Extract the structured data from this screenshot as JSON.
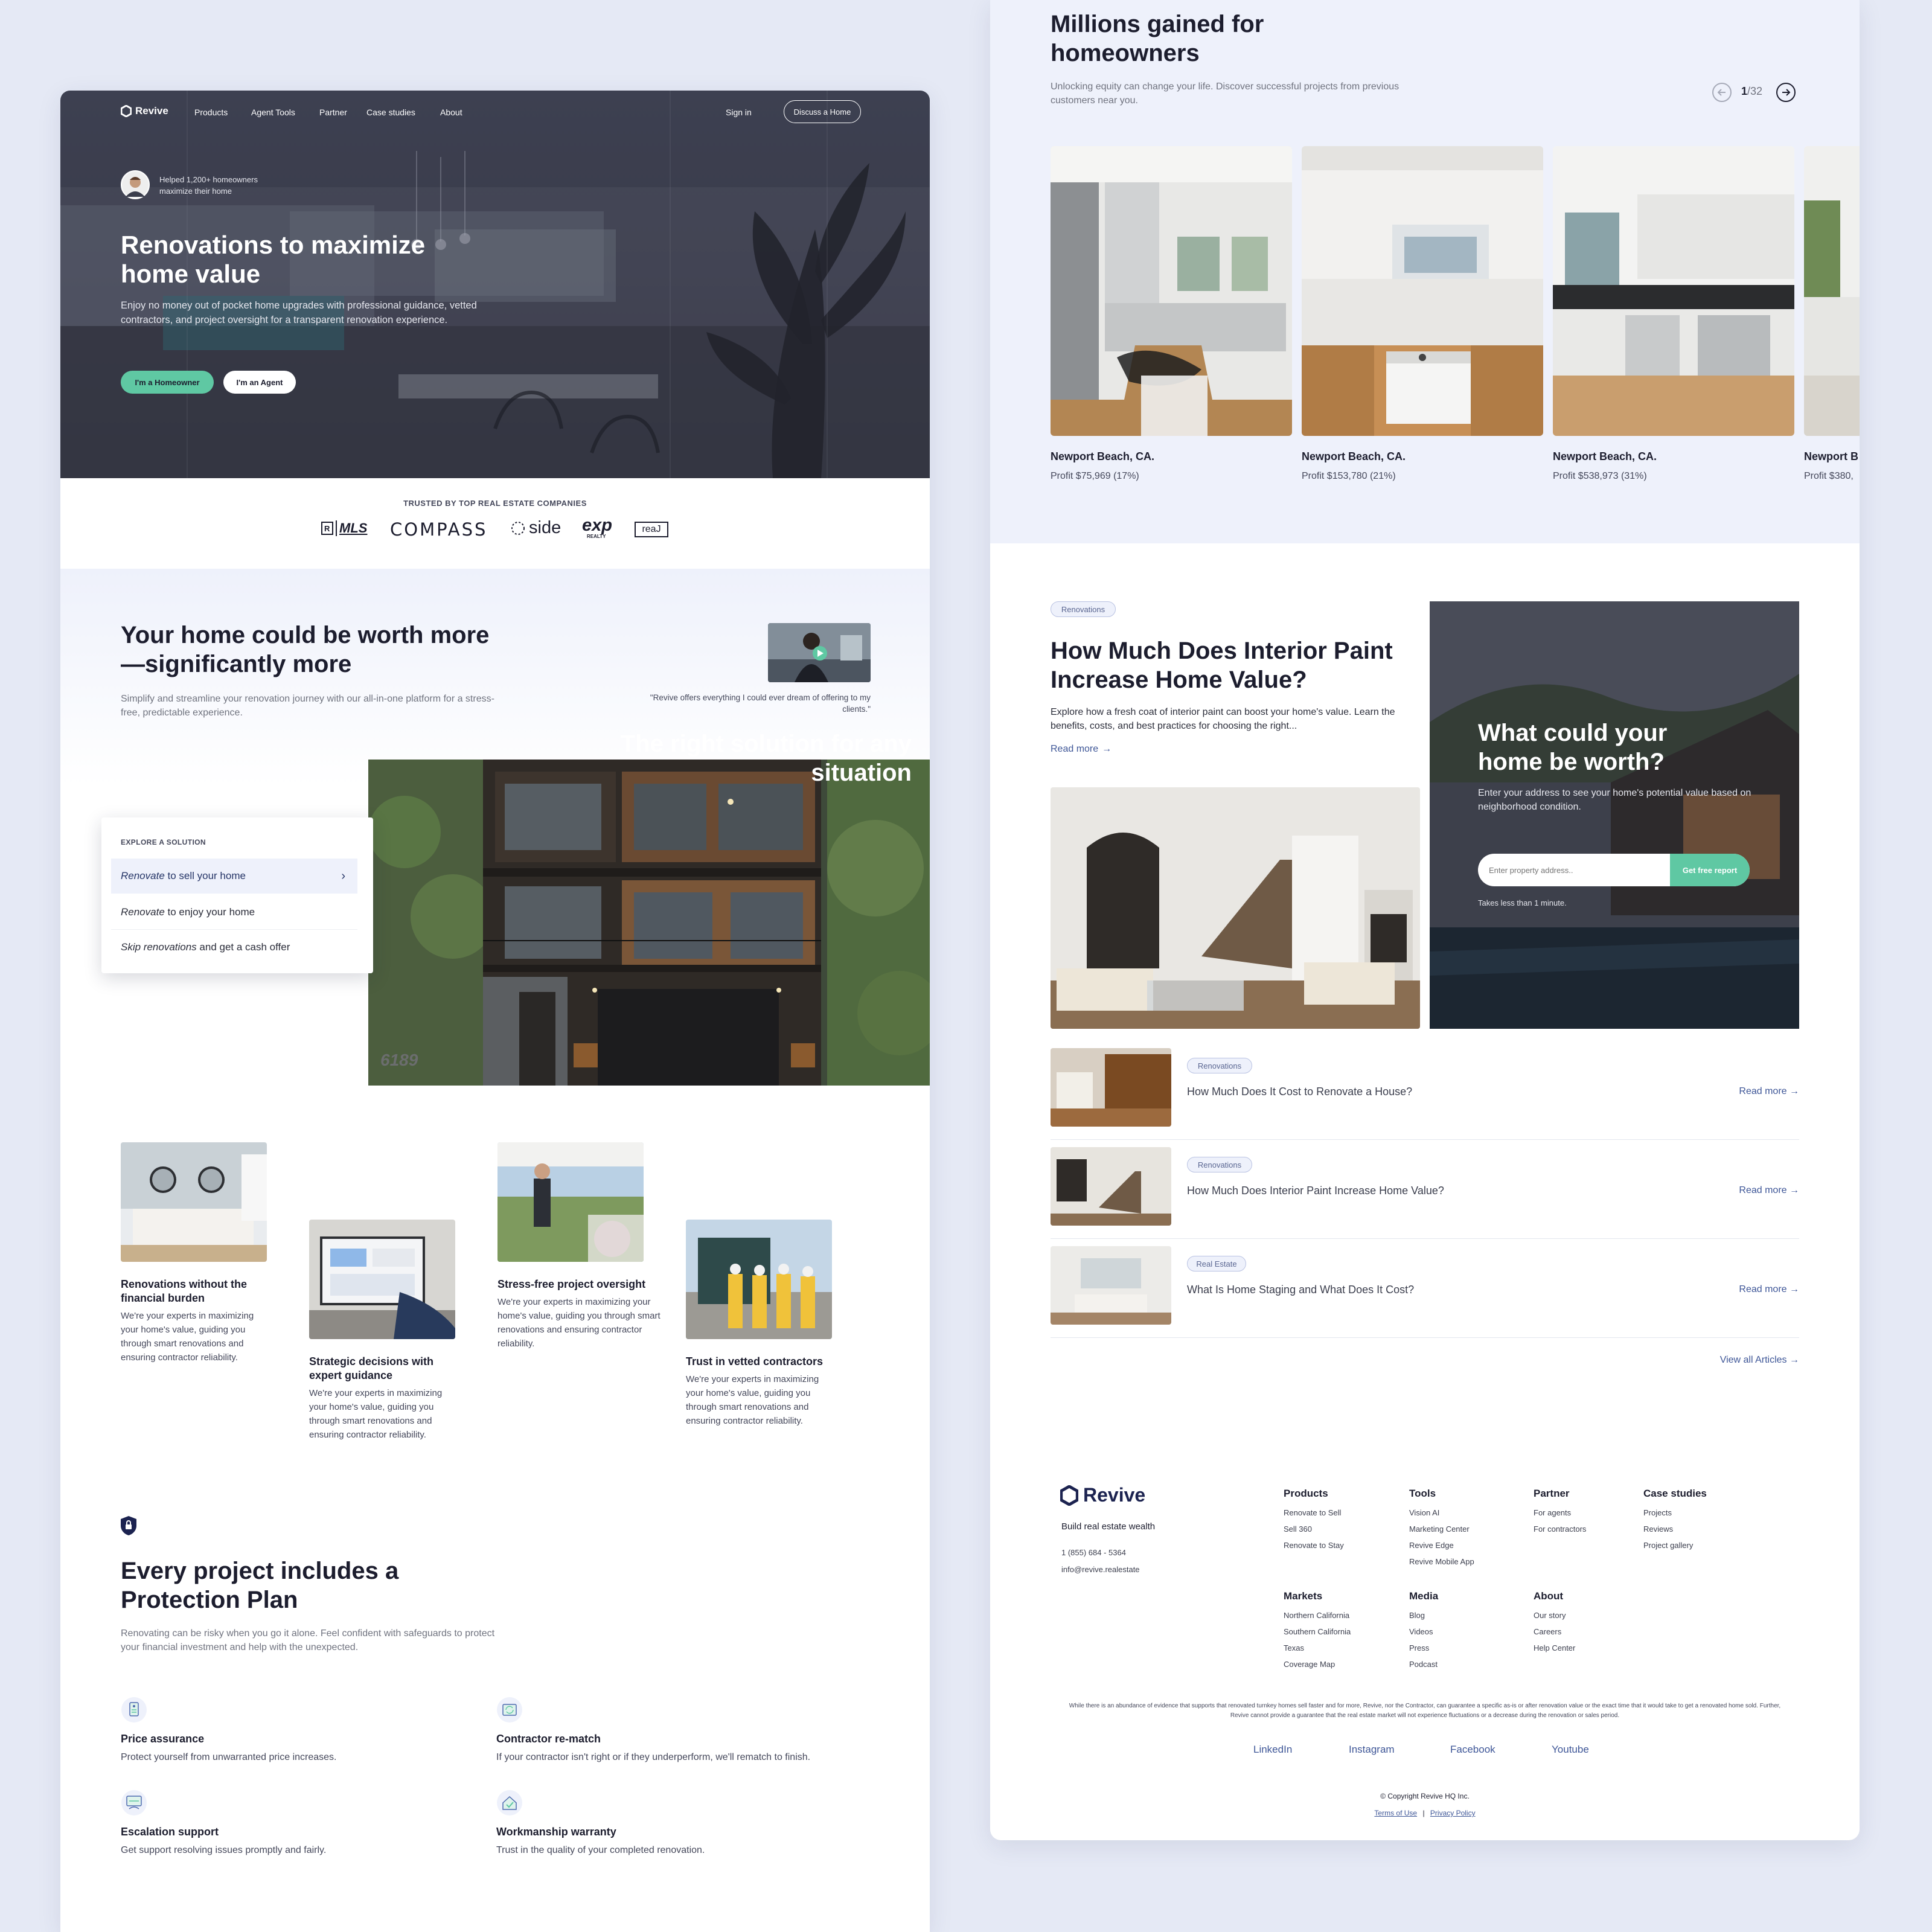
{
  "colors": {
    "accent_green": "#5fc8a3",
    "brand_navy": "#1c2350",
    "link_blue": "#3e5697",
    "bg_lavender": "#e5e9f5",
    "section_tint": "#eef1fb"
  },
  "nav": {
    "logo": "Revive",
    "items": [
      "Products",
      "Agent Tools",
      "Partner",
      "Case studies",
      "About"
    ],
    "sign_in": "Sign in",
    "cta": "Discuss a Home"
  },
  "hero": {
    "badge_line1": "Helped 1,200+ homeowners",
    "badge_line2": "maximize their home",
    "title": "Renovations to maximize home value",
    "subtitle": "Enjoy no money out of pocket home upgrades with professional guidance, vetted contractors, and project oversight for a transparent renovation experience.",
    "btn_homeowner": "I'm a Homeowner",
    "btn_agent": "I'm an Agent"
  },
  "trusted": {
    "label": "TRUSTED BY TOP REAL ESTATE COMPANIES",
    "logos": [
      "MLS",
      "COMPASS",
      "side",
      "exp",
      "reaJ"
    ],
    "exp_sub": "REALTY"
  },
  "worth": {
    "title": "Your home could be worth more—significantly more",
    "subtitle": "Simplify and streamline your renovation journey with our all-in-one platform for a stress-free, predictable experience.",
    "quote": "\"Revive offers everything I could ever dream of offering to my clients.\""
  },
  "solution": {
    "eyebrow": "EXPLORE A SOLUTION",
    "image_title": "The right solution for any situation",
    "house_number": "6189",
    "items": [
      {
        "em": "Renovate",
        "rest": " to sell your home"
      },
      {
        "em": "Renovate",
        "rest": " to enjoy your home"
      },
      {
        "em": "Skip renovations",
        "rest": " and get a cash offer"
      }
    ]
  },
  "features": [
    {
      "title": "Renovations without the financial burden",
      "text": "We're your experts in maximizing your home's value, guiding you through smart renovations and ensuring contractor reliability."
    },
    {
      "title": "Strategic decisions with expert guidance",
      "text": "We're your experts in maximizing your home's value, guiding you through smart renovations and ensuring contractor reliability."
    },
    {
      "title": "Stress-free project oversight",
      "text": "We're your experts in maximizing your home's value, guiding you through smart renovations and ensuring contractor reliability."
    },
    {
      "title": "Trust in vetted contractors",
      "text": "We're your experts in maximizing your home's value, guiding you through smart renovations and ensuring contractor reliability."
    }
  ],
  "protection": {
    "title": "Every project includes a Protection Plan",
    "subtitle": "Renovating can be risky when you go it alone. Feel confident with safeguards to protect your financial investment and help with the unexpected.",
    "items": [
      {
        "title": "Price assurance",
        "text": "Protect yourself from unwarranted price increases.",
        "icon": "price-tag-icon"
      },
      {
        "title": "Contractor re-match",
        "text": "If your contractor isn't right or if they underperform, we'll rematch to finish.",
        "icon": "rematch-icon"
      },
      {
        "title": "Escalation support",
        "text": "Get support resolving issues promptly and fairly.",
        "icon": "support-icon"
      },
      {
        "title": "Workmanship warranty",
        "text": "Trust in the quality of your completed renovation.",
        "icon": "warranty-icon"
      }
    ]
  },
  "millions": {
    "title": "Millions gained for homeowners",
    "subtitle": "Unlocking equity can change your life. Discover successful projects from previous customers near you.",
    "page_current": "1",
    "page_total": "/32",
    "projects": [
      {
        "location": "Newport Beach, CA.",
        "profit": "Profit $75,969 (17%)"
      },
      {
        "location": "Newport Beach, CA.",
        "profit": "Profit $153,780 (21%)"
      },
      {
        "location": "Newport Beach, CA.",
        "profit": "Profit $538,973 (31%)"
      },
      {
        "location": "Newport B",
        "profit": "Profit $380,"
      }
    ]
  },
  "article": {
    "tag": "Renovations",
    "title": "How Much Does Interior Paint Increase Home Value?",
    "excerpt": "Explore how a fresh coat of interior paint can boost your home's value. Learn the benefits, costs, and best practices for choosing the right...",
    "read_more": "Read more"
  },
  "worth_card": {
    "title": "What could your home be worth?",
    "subtitle": "Enter your address to see your home's potential value based on neighborhood condition.",
    "placeholder": "Enter property address..",
    "button": "Get free report",
    "note": "Takes less than 1 minute."
  },
  "articles": [
    {
      "tag": "Renovations",
      "title": "How Much Does It Cost to Renovate a House?",
      "read_more": "Read more"
    },
    {
      "tag": "Renovations",
      "title": "How Much Does Interior Paint Increase Home Value?",
      "read_more": "Read more"
    },
    {
      "tag": "Real Estate",
      "title": "What Is Home Staging and What Does It Cost?",
      "read_more": "Read more"
    }
  ],
  "view_all": "View all Articles",
  "footer": {
    "logo": "Revive",
    "tagline": "Build real estate wealth",
    "phone": "1 (855) 684 - 5364",
    "email": "info@revive.realestate",
    "columns": [
      {
        "head": "Products",
        "links": [
          "Renovate to Sell",
          "Sell 360",
          "Renovate to Stay"
        ]
      },
      {
        "head": "Tools",
        "links": [
          "Vision AI",
          "Marketing Center",
          "Revive Edge",
          "Revive Mobile App"
        ]
      },
      {
        "head": "Partner",
        "links": [
          "For agents",
          "For contractors"
        ]
      },
      {
        "head": "Case studies",
        "links": [
          "Projects",
          "Reviews",
          "Project gallery"
        ]
      },
      {
        "head": "Markets",
        "links": [
          "Northern California",
          "Southern California",
          "Texas",
          "Coverage Map"
        ]
      },
      {
        "head": "Media",
        "links": [
          "Blog",
          "Videos",
          "Press",
          "Podcast"
        ]
      },
      {
        "head": "About",
        "links": [
          "Our story",
          "Careers",
          "Help Center"
        ]
      }
    ],
    "disclaimer": "While there is an abundance of evidence that supports that renovated turnkey homes sell faster and for more, Revive, nor the Contractor, can guarantee a specific as-is or after renovation value or the exact time that it would take to get a renovated home sold. Further, Revive cannot provide a guarantee that the real estate market will not experience fluctuations or a decrease during the renovation or sales period.",
    "social": [
      "LinkedIn",
      "Instagram",
      "Facebook",
      "Youtube"
    ],
    "copyright": "© Copyright Revive HQ Inc.",
    "terms": "Terms of Use",
    "separator": "|",
    "privacy": "Privacy Policy"
  }
}
